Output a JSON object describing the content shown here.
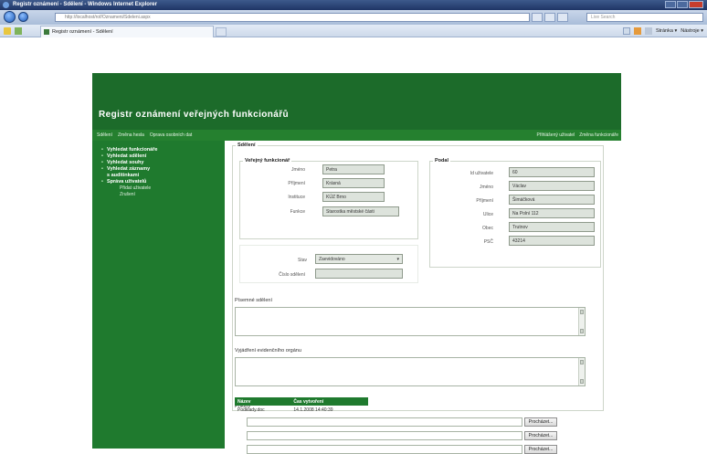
{
  "browser": {
    "window_title": "Registr oznámení - Sdělení - Windows Internet Explorer",
    "address": "http://localhost/rof/Oznameni/Sdeleni.aspx",
    "search_placeholder": "Live Search",
    "tab_title": "Registr oznámení - Sdělení",
    "commands": [
      "Stránka ▾",
      "Nástroje ▾"
    ]
  },
  "site": {
    "title": "Registr oznámení veřejných funkcionářů",
    "menu_left": [
      "Sdělení",
      "Změna hesla",
      "Oprava osobních dat"
    ],
    "menu_right": [
      "Přihlášený uživatel",
      "Změna funkcionáře"
    ]
  },
  "sidebar": {
    "items": [
      {
        "label": "Vyhledat funkcionáře"
      },
      {
        "label": "Vyhledat sdělení"
      },
      {
        "label": "Vyhledat souhy"
      },
      {
        "label": "Vyhledat záznamy"
      },
      {
        "label": "Správa uživatelů"
      }
    ],
    "item4_line2": "s auditinkami",
    "subitems": [
      "Přidat uživatele",
      "Zrušení"
    ]
  },
  "form": {
    "legend": "Sdělení",
    "official": {
      "legend": "Veřejný funkcionář",
      "fields": [
        {
          "label": "Jméno",
          "value": "Petra"
        },
        {
          "label": "Příjmení",
          "value": "Krásná"
        },
        {
          "label": "Instituce",
          "value": "KÚZ Brno"
        },
        {
          "label": "Funkce",
          "value": "Starostka městské části"
        }
      ]
    },
    "user": {
      "legend": "Podal",
      "fields": [
        {
          "label": "Id uživatele",
          "value": "60"
        },
        {
          "label": "Jméno",
          "value": "Václav"
        },
        {
          "label": "Příjmení",
          "value": "Šimáčková"
        },
        {
          "label": "Ulice",
          "value": "Na Polní 112"
        },
        {
          "label": "Obec",
          "value": "Trutnov"
        },
        {
          "label": "PSČ",
          "value": "43214"
        }
      ]
    },
    "status_label": "Stav",
    "status_value": "Zaevidováno",
    "number_label": "Číslo sdělení",
    "number_value": "",
    "text_label": "Písemné sdělení",
    "response_label": "Vyjádření evidenčního orgánu",
    "attachments_label": "Přílohy",
    "browse_label": "Procházet...",
    "table": {
      "headers": [
        "Název",
        "Čas vytvoření"
      ],
      "rows": [
        [
          "Podklady.doc",
          "14.1.2008 14:40:39"
        ]
      ]
    }
  },
  "colors": {
    "header": "#1c6b2a",
    "sidebar": "#1f7a2e",
    "menubar": "#25802f"
  }
}
